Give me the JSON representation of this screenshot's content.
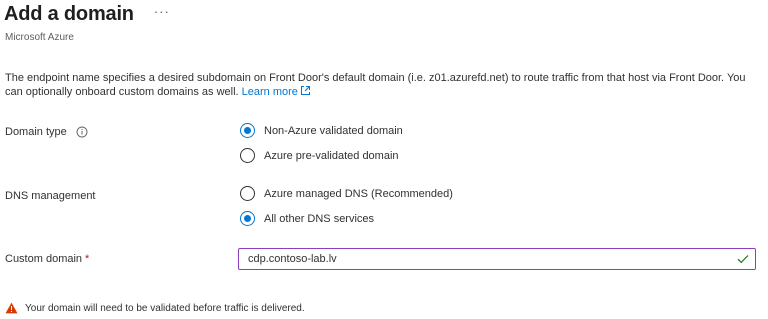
{
  "header": {
    "title": "Add a domain",
    "more_label": "···",
    "subtitle": "Microsoft Azure"
  },
  "description": {
    "text": "The endpoint name specifies a desired subdomain on Front Door's default domain (i.e. z01.azurefd.net) to route traffic from that host via Front Door. You can optionally onboard custom domains as well. ",
    "link_label": "Learn more"
  },
  "domain_type": {
    "label": "Domain type",
    "options": [
      {
        "label": "Non-Azure validated domain",
        "checked": true
      },
      {
        "label": "Azure pre-validated domain",
        "checked": false
      }
    ]
  },
  "dns_management": {
    "label": "DNS management",
    "options": [
      {
        "label": "Azure managed DNS (Recommended)",
        "checked": false
      },
      {
        "label": "All other DNS services",
        "checked": true
      }
    ]
  },
  "custom_domain": {
    "label": "Custom domain",
    "required_mark": "*",
    "value": "cdp.contoso-lab.lv"
  },
  "warning": {
    "text": "Your domain will need to be validated before traffic is delivered."
  },
  "colors": {
    "accent": "#0078d4",
    "valid": "#107c10",
    "warning": "#d83b01",
    "input_border": "#8a3fbf"
  },
  "icons": {
    "more": "ellipsis-icon",
    "external": "external-link-icon",
    "info": "info-icon",
    "valid": "checkmark-icon",
    "warning": "warning-icon"
  }
}
